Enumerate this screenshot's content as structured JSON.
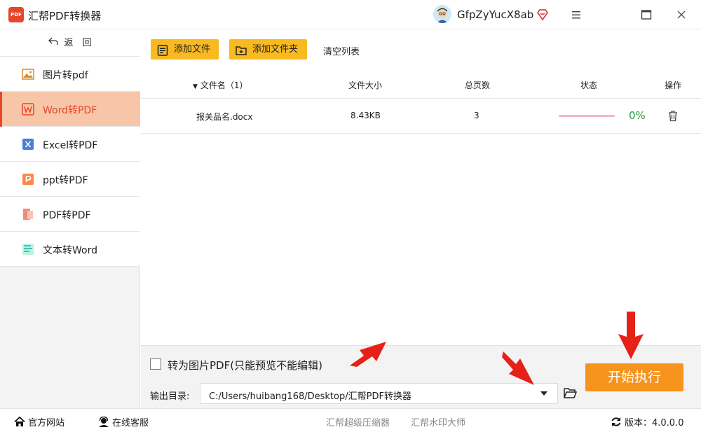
{
  "app": {
    "title": "汇帮PDF转换器",
    "logo_text": "PDF",
    "username": "GfpZyYucX8ab",
    "icons": {
      "avatar": "avatar",
      "vip": "diamond-heart-icon",
      "menu": "hamburger-icon",
      "maximize": "maximize-icon",
      "close": "close-icon"
    }
  },
  "sidebar": {
    "back_label": "返　回",
    "items": [
      {
        "label": "图片转pdf",
        "icon": "image-icon",
        "color": "#f0a040"
      },
      {
        "label": "Word转PDF",
        "icon": "word-icon",
        "color": "#e8452b",
        "active": true
      },
      {
        "label": "Excel转PDF",
        "icon": "excel-icon",
        "color": "#4a7fd6"
      },
      {
        "label": "ppt转PDF",
        "icon": "ppt-icon",
        "color": "#f7894a"
      },
      {
        "label": "PDF转PDF",
        "icon": "pdf-icon",
        "color": "#f48a7a"
      },
      {
        "label": "文本转Word",
        "icon": "text-icon",
        "color": "#3dc7b0"
      }
    ]
  },
  "toolbar": {
    "add_file": "添加文件",
    "add_folder": "添加文件夹",
    "clear": "清空列表"
  },
  "table": {
    "headers": {
      "name": "文件名（1）",
      "size": "文件大小",
      "pages": "总页数",
      "status": "状态",
      "ops": "操作"
    },
    "rows": [
      {
        "name": "报关品名.docx",
        "size": "8.43KB",
        "pages": "3",
        "progress": 0,
        "percent": "0%"
      }
    ]
  },
  "options": {
    "to_image_label": "转为图片PDF(只能预览不能编辑)",
    "to_image_checked": false,
    "output_label": "输出目录:",
    "output_path": "C:/Users/huibang168/Desktop/汇帮PDF转换器",
    "start_label": "开始执行"
  },
  "statusbar": {
    "home": "官方网站",
    "service": "在线客服",
    "compress": "汇帮超级压缩器",
    "watermark": "汇帮水印大师",
    "version": "版本：4.0.0.0"
  },
  "colors": {
    "accent": "#f8b921",
    "start": "#f7941d",
    "active_nav": "#f7c6a8",
    "brand_red": "#e8452b",
    "progress_text": "#2e9d3e",
    "annotation_arrow": "#e62117"
  }
}
